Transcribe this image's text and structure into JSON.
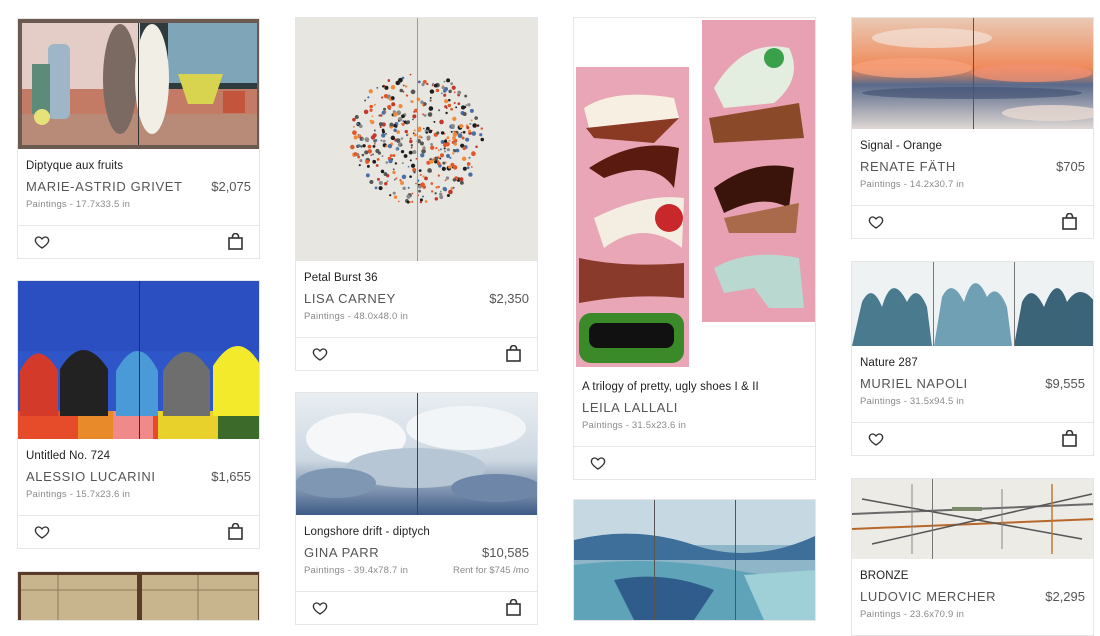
{
  "icons": {
    "favorite": "heart-icon",
    "cart": "shopping-bag-icon"
  },
  "cards": [
    {
      "id": "c1",
      "title": "Diptyque aux fruits",
      "artist": "MARIE-ASTRID GRIVET",
      "price": "$2,075",
      "meta": "Paintings - 17.7x33.5 in"
    },
    {
      "id": "c2",
      "title": "Untitled No. 724",
      "artist": "ALESSIO LUCARINI",
      "price": "$1,655",
      "meta": "Paintings - 15.7x23.6 in"
    },
    {
      "id": "c3",
      "title": "Petal Burst 36",
      "artist": "LISA CARNEY",
      "price": "$2,350",
      "meta": "Paintings - 48.0x48.0 in"
    },
    {
      "id": "c4",
      "title": "Longshore drift - diptych",
      "artist": "GINA PARR",
      "price": "$10,585",
      "meta": "Paintings - 39.4x78.7 in",
      "rent": "Rent for $745 /mo"
    },
    {
      "id": "c5",
      "title": "A trilogy of pretty, ugly shoes I & II",
      "artist": "LEILA LALLALI",
      "price": "",
      "meta": "Paintings - 31.5x23.6 in"
    },
    {
      "id": "c6",
      "title": "Signal - Orange",
      "artist": "RENATE FÄTH",
      "price": "$705",
      "meta": "Paintings - 14.2x30.7 in"
    },
    {
      "id": "c7",
      "title": "Nature 287",
      "artist": "MURIEL NAPOLI",
      "price": "$9,555",
      "meta": "Paintings - 31.5x94.5 in"
    },
    {
      "id": "c8",
      "title": "BRONZE",
      "artist": "LUDOVIC MERCHER",
      "price": "$2,295",
      "meta": "Paintings - 23.6x70.9 in"
    }
  ]
}
